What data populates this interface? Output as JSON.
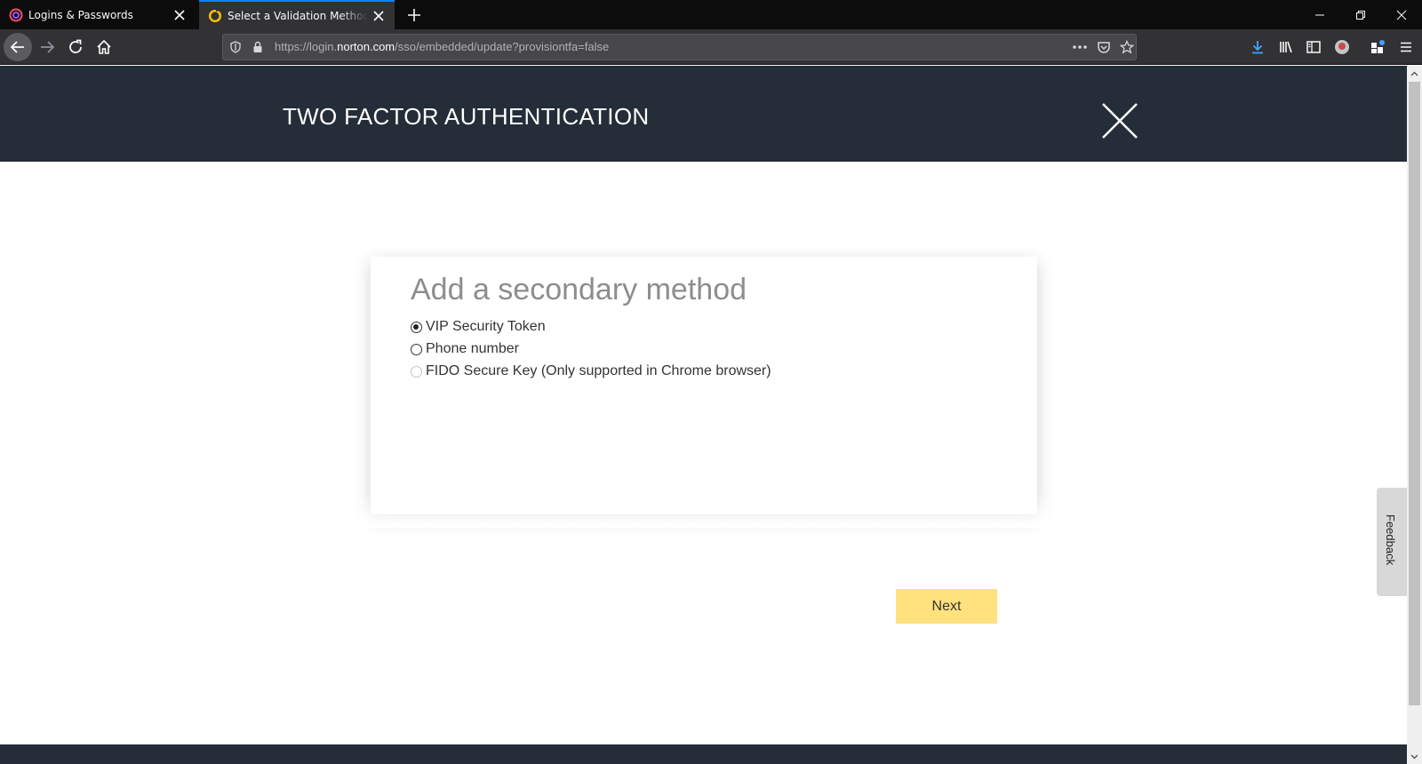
{
  "browser": {
    "tabs": [
      {
        "title": "Logins & Passwords",
        "active": false
      },
      {
        "title": "Select a Validation Method - Of",
        "active": true
      }
    ],
    "url": {
      "prefix": "https://login.",
      "domain": "norton.com",
      "path": "/sso/embedded/update?provisiontfa=false"
    },
    "colors": {
      "accent": "#0a84ff",
      "tab_active_bg": "#323234"
    }
  },
  "header": {
    "title": "TWO FACTOR AUTHENTICATION"
  },
  "card": {
    "title": "Add a secondary method",
    "options": [
      {
        "label": "VIP Security Token",
        "checked": true,
        "disabled": false
      },
      {
        "label": "Phone number",
        "checked": false,
        "disabled": false
      },
      {
        "label": "FIDO Secure Key (Only supported in Chrome browser)",
        "checked": false,
        "disabled": true
      }
    ]
  },
  "actions": {
    "next_label": "Next",
    "next_color": "#ffe17d"
  },
  "feedback": {
    "label": "Feedback"
  },
  "theme": {
    "header_bg": "#242d38"
  }
}
